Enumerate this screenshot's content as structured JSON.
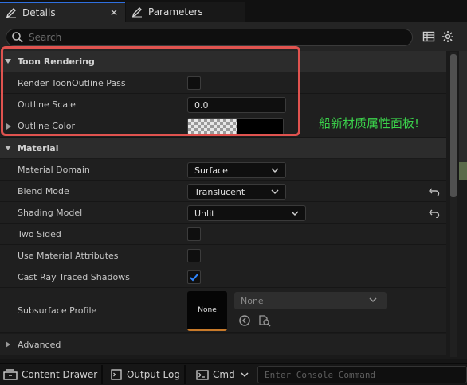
{
  "tabs": {
    "details_label": "Details",
    "close_glyph": "✕",
    "parameters_label": "Parameters"
  },
  "search": {
    "placeholder": "Search"
  },
  "toon": {
    "title": "Toon Rendering",
    "render_pass_label": "Render ToonOutline Pass",
    "render_pass_checked": false,
    "outline_scale_label": "Outline Scale",
    "outline_scale_value": "0.0",
    "outline_color_label": "Outline Color"
  },
  "annotation": {
    "text": "船新材质属性面板!",
    "color": "#3bd24b"
  },
  "material": {
    "title": "Material",
    "domain_label": "Material Domain",
    "domain_value": "Surface",
    "blend_label": "Blend Mode",
    "blend_value": "Translucent",
    "shading_label": "Shading Model",
    "shading_value": "Unlit",
    "two_sided_label": "Two Sided",
    "two_sided_checked": false,
    "use_attrs_label": "Use Material Attributes",
    "use_attrs_checked": false,
    "cast_ray_label": "Cast Ray Traced Shadows",
    "cast_ray_checked": true,
    "subsurface_label": "Subsurface Profile",
    "subsurface_thumb": "None",
    "subsurface_dropdown": "None"
  },
  "advanced": {
    "title": "Advanced"
  },
  "bottom": {
    "content_drawer": "Content Drawer",
    "output_log": "Output Log",
    "cmd": "Cmd",
    "console_placeholder": "Enter Console Command"
  },
  "colors": {
    "accent": "#2f70e0",
    "annotation_box": "#e0534f",
    "thumb_underline": "#c87a2a"
  }
}
